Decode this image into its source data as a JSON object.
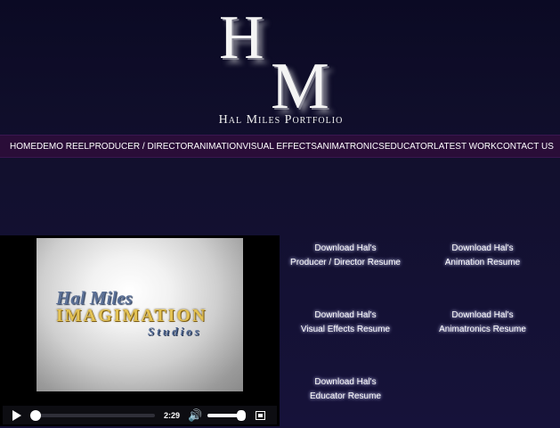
{
  "logo": {
    "letter_h": "H",
    "letter_m": "M",
    "subtitle": "Hal Miles Portfolio"
  },
  "nav": {
    "items": [
      "HOME",
      "DEMO REEL",
      "PRODUCER / DIRECTOR",
      "ANIMATION",
      "VISUAL EFFECTS",
      "ANIMATRONICS",
      "EDUCATOR",
      "LATEST WORK",
      "CONTACT US"
    ]
  },
  "video": {
    "title_line1": "Hal Miles",
    "title_line2": "IMAGIMATION",
    "title_line3": "Studios",
    "duration": "2:29",
    "progress": 0.0,
    "volume": 1.0
  },
  "downloads": [
    {
      "line1": "Download Hal's",
      "line2": "Producer / Director Resume"
    },
    {
      "line1": "Download Hal's",
      "line2": "Animation Resume"
    },
    {
      "line1": "Download Hal's",
      "line2": "Visual Effects Resume"
    },
    {
      "line1": "Download Hal's",
      "line2": "Animatronics Resume"
    },
    {
      "line1": "Download Hal's",
      "line2": "Educator Resume"
    }
  ],
  "colors": {
    "nav_bg": "#2a0d38",
    "page_bg": "#12102e",
    "gold": "#e3c254",
    "steel_blue": "#5a6f95"
  }
}
